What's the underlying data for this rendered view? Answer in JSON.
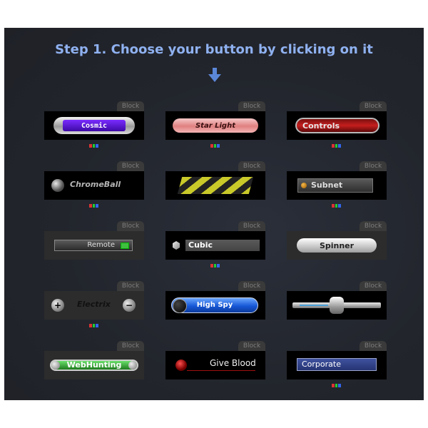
{
  "header": {
    "title": "Step 1. Choose your button by clicking on it",
    "arrow_icon": "down-arrow-icon"
  },
  "tab_label": "Block",
  "colors": {
    "panel_bg": "#22252c",
    "title_color": "#8fb1f0",
    "swatch_red": "#dd3333",
    "swatch_green": "#22cc33",
    "swatch_blue": "#3366ee"
  },
  "buttons": [
    {
      "label": "Cosmic",
      "swatches": true
    },
    {
      "label": "Star Light",
      "swatches": true
    },
    {
      "label": "Controls",
      "swatches": true
    },
    {
      "label": "ChromeBall",
      "swatches": true
    },
    {
      "label": "",
      "swatches": false
    },
    {
      "label": "Subnet",
      "swatches": true
    },
    {
      "label": "Remote",
      "swatches": false
    },
    {
      "label": "Cubic",
      "swatches": true
    },
    {
      "label": "Spinner",
      "swatches": false
    },
    {
      "label": "Electrix",
      "swatches": true
    },
    {
      "label": "High Spy",
      "swatches": false
    },
    {
      "label": "",
      "swatches": false
    },
    {
      "label": "WebHunting",
      "swatches": false
    },
    {
      "label": "Give Blood",
      "swatches": false
    },
    {
      "label": "Corporate",
      "swatches": true
    }
  ]
}
